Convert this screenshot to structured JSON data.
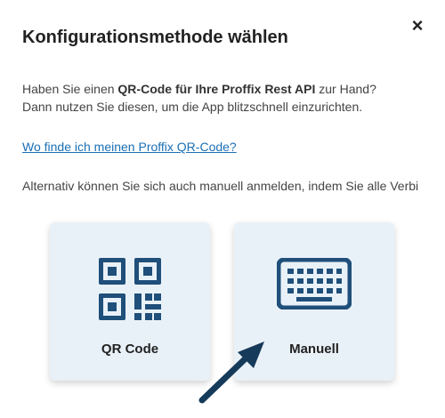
{
  "dialog": {
    "title": "Konfigurationsmethode wählen",
    "close_glyph": "×",
    "intro": {
      "line1_pre": "Haben Sie einen ",
      "line1_bold": "QR-Code für Ihre Proffix Rest API",
      "line1_post": " zur Hand?",
      "line2": "Dann nutzen Sie diesen, um die App blitzschnell einzurichten."
    },
    "help_link": "Wo finde ich meinen Proffix QR-Code?",
    "alternative": "Alternativ können Sie sich auch manuell anmelden, indem Sie alle Verbi",
    "options": [
      {
        "label": "QR Code",
        "icon": "qr-code-icon"
      },
      {
        "label": "Manuell",
        "icon": "keyboard-icon"
      }
    ]
  },
  "colors": {
    "icon": "#1f4f7a",
    "card_bg": "#e9f1f8",
    "link": "#1a6fb5",
    "arrow": "#163a5a"
  }
}
